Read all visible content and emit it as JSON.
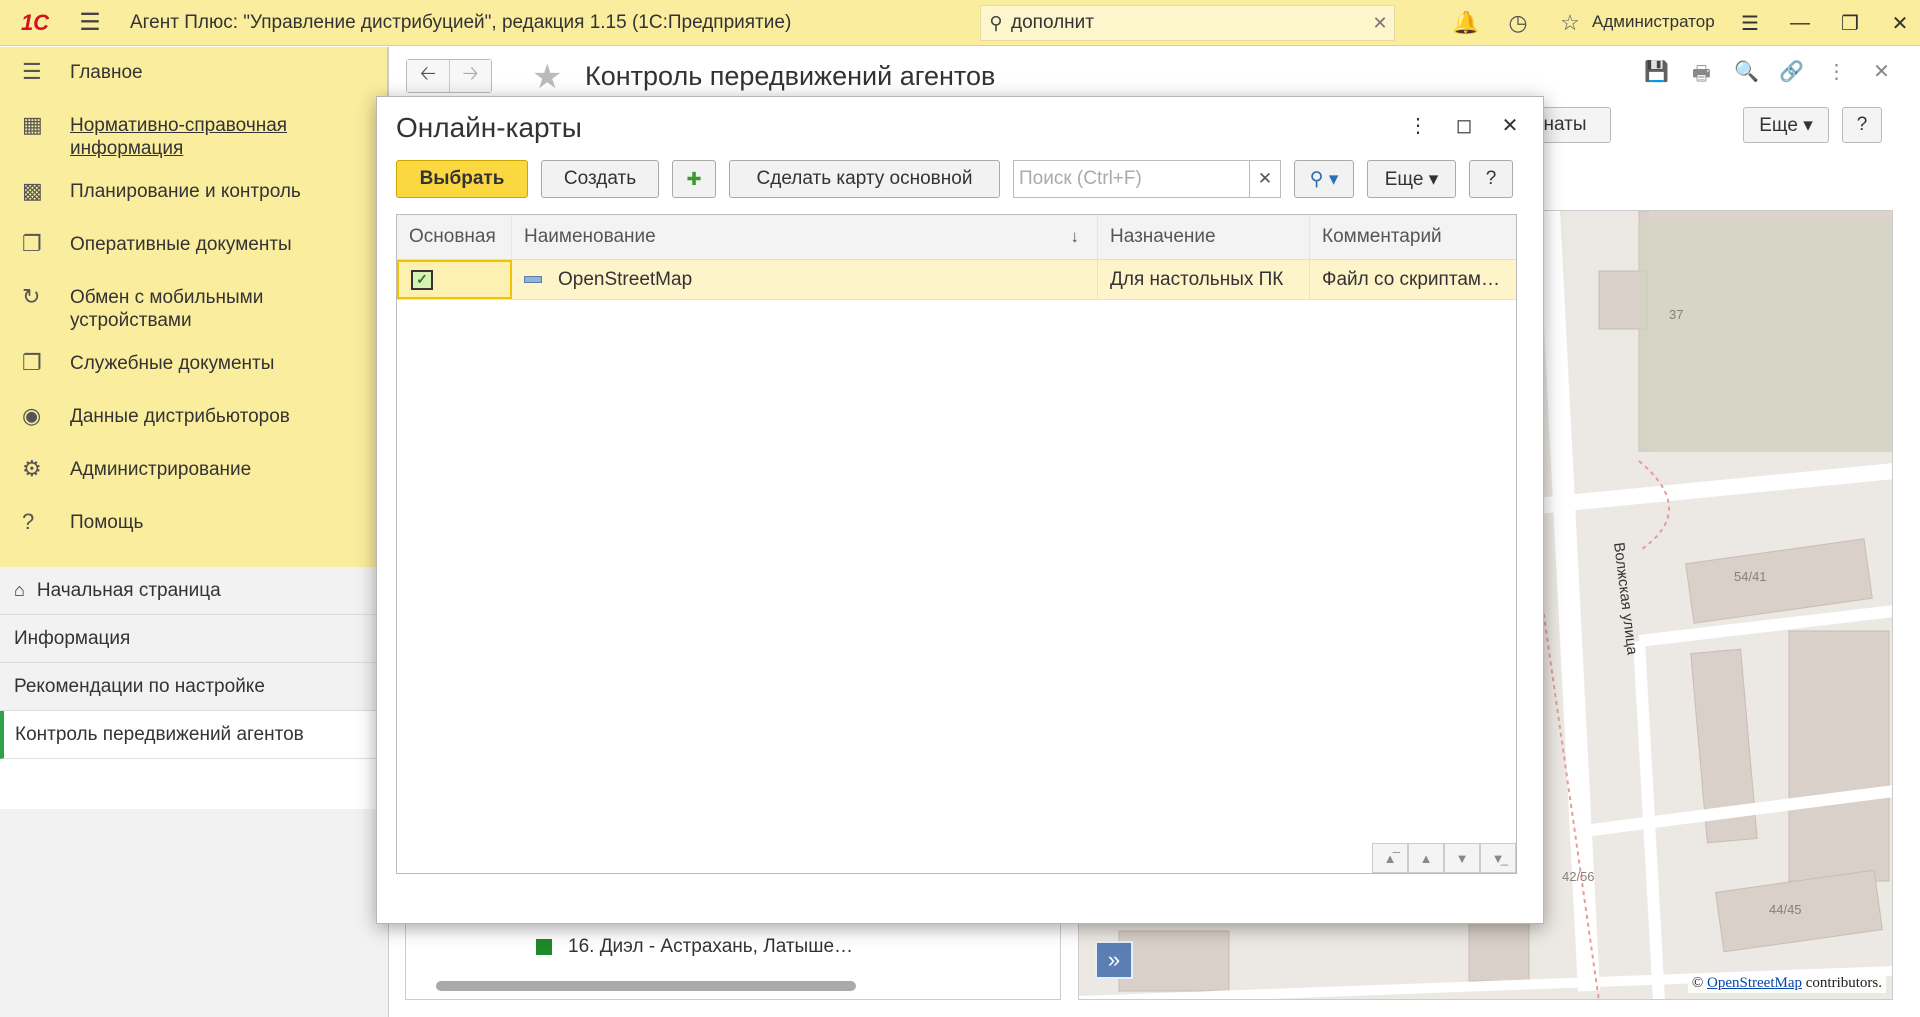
{
  "topbar": {
    "logo": "1С",
    "app_title": "Агент Плюс: \"Управление дистрибуцией\", редакция 1.15  (1С:Предприятие)",
    "search_value": "дополнит",
    "user_name": "Администратор"
  },
  "sidebar": {
    "sections": [
      {
        "label": "Главное"
      },
      {
        "label": "Нормативно-справочная информация"
      },
      {
        "label": "Планирование и контроль"
      },
      {
        "label": "Оперативные документы"
      },
      {
        "label": "Обмен с мобильными устройствами"
      },
      {
        "label": "Служебные документы"
      },
      {
        "label": "Данные дистрибьюторов"
      },
      {
        "label": "Администрирование"
      },
      {
        "label": "Помощь"
      }
    ],
    "open_windows": [
      {
        "label": "Начальная страница"
      },
      {
        "label": "Информация"
      },
      {
        "label": "Рекомендации по настройке"
      },
      {
        "label": "Контроль передвижений агентов"
      }
    ]
  },
  "main": {
    "title": "Контроль передвижений агентов",
    "btn_partial": "наты",
    "btn_more": "Еще ▾",
    "btn_help": "?",
    "list_row": "16. Диэл  -  Астрахань, Латыше…"
  },
  "map": {
    "labels": [
      "37",
      "54/41",
      "Волжская улица",
      "42/56",
      "44/45"
    ],
    "attribution_prefix": "©",
    "attribution_link": "OpenStreetMap",
    "attribution_suffix": "contributors."
  },
  "modal": {
    "title": "Онлайн-карты",
    "toolbar": {
      "select": "Выбрать",
      "create": "Создать",
      "make_default": "Сделать карту основной",
      "search_placeholder": "Поиск (Ctrl+F)",
      "more": "Еще ▾",
      "help": "?"
    },
    "columns": [
      "Основная",
      "Наименование",
      "Назначение",
      "Комментарий"
    ],
    "rows": [
      {
        "name": "OpenStreetMap",
        "purpose": "Для настольных ПК",
        "comment": "Файл со скриптам…"
      }
    ]
  },
  "colors": {
    "topbar_bg": "#fbed9e",
    "primary_button": "#fcd840",
    "selected_row": "#fdf4c9",
    "active_tab_accent": "#2ea34a"
  }
}
